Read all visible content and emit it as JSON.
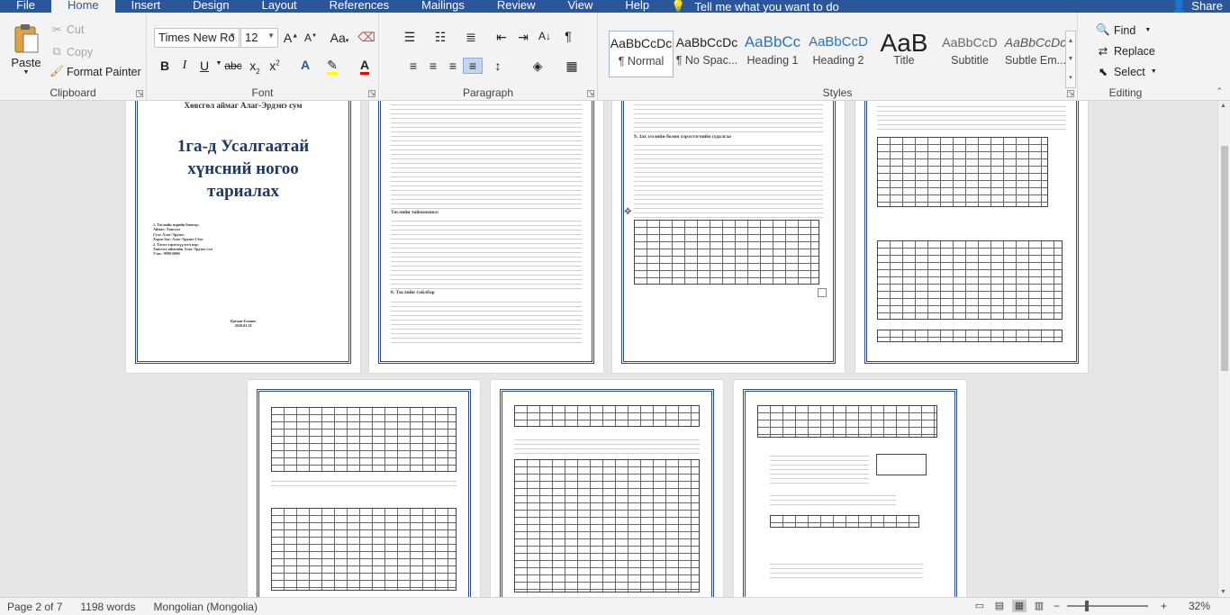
{
  "tabs": [
    "File",
    "Home",
    "Insert",
    "Design",
    "Layout",
    "References",
    "Mailings",
    "Review",
    "View",
    "Help"
  ],
  "active_tab": "Home",
  "tell_me": "Tell me what you want to do",
  "share": "Share",
  "clipboard": {
    "paste": "Paste",
    "cut": "Cut",
    "copy": "Copy",
    "format_painter": "Format Painter",
    "label": "Clipboard"
  },
  "font": {
    "name": "Times New Ro",
    "size": "12",
    "label": "Font"
  },
  "paragraph": {
    "label": "Paragraph"
  },
  "styles": {
    "label": "Styles",
    "items": [
      {
        "sample": "AaBbCcDc",
        "name": "¶ Normal"
      },
      {
        "sample": "AaBbCcDc",
        "name": "¶ No Spac..."
      },
      {
        "sample": "AaBbCc",
        "name": "Heading 1"
      },
      {
        "sample": "AaBbCcD",
        "name": "Heading 2"
      },
      {
        "sample": "AaB",
        "name": "Title"
      },
      {
        "sample": "AaBbCcD",
        "name": "Subtitle"
      },
      {
        "sample": "AaBbCcDc",
        "name": "Subtle Em..."
      }
    ]
  },
  "editing": {
    "find": "Find",
    "replace": "Replace",
    "select": "Select",
    "label": "Editing"
  },
  "document": {
    "cover_top": "Хөвсгөл аймаг Алаг-Эрдэнэ сум",
    "cover_title": "1га-д Усалгаатай хүнсний ногоо тариалах",
    "cover_lines": [
      "1.   Төслийн нэрийн бичвэр:",
      "Аймаг: Хөвсгөл",
      "Сум: Алаг-Эрдэнэ",
      "Хороо баг: Алаг-Эрдэнэ 2 баг",
      "2.   Төсөл хэрэгжүүлэгч нэр:",
      "Хөвсгөл аймгийн Алаг-Эрдэнэ сум",
      "Утас: 9999-0000"
    ],
    "cover_bottom": "Цагаан-Бохинг\n2020.03.18",
    "page2_heading1": "Төслийн тоймзохиол:",
    "page2_heading2": "8. Төслийн тайлбар",
    "page3_heading": "9. Зах зээлийн болон хэрэглэгчийн судалгаа"
  },
  "status": {
    "page": "Page 2 of 7",
    "words": "1198 words",
    "language": "Mongolian (Mongolia)",
    "zoom": "32%"
  }
}
